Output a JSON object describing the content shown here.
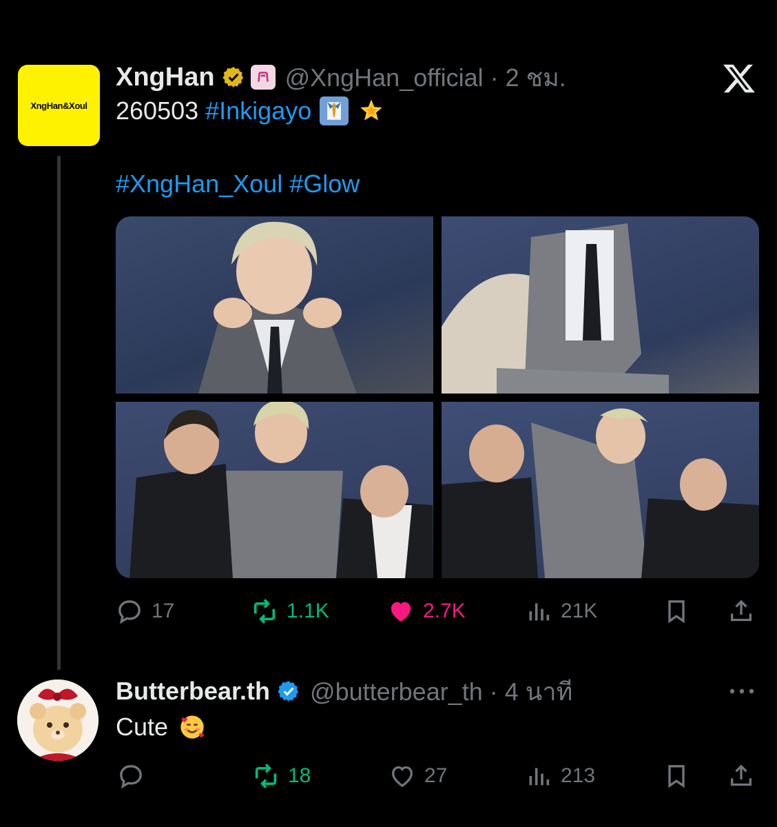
{
  "main_tweet": {
    "avatar_text": "XngHan&Xoul",
    "display_name": "XngHan",
    "handle_time": "@XngHan_official · 2 ชม.",
    "line1_prefix": "260503 ",
    "line1_tag": "#Inkigayo",
    "line2_tag1": "#XngHan_Xoul",
    "line2_tag2": "#Glow",
    "stats": {
      "replies": "17",
      "reposts": "1.1K",
      "likes": "2.7K",
      "views": "21K"
    }
  },
  "reply_tweet": {
    "display_name": "Butterbear.th",
    "handle_time": "@butterbear_th · 4 นาที",
    "text": "Cute",
    "stats": {
      "replies": "",
      "reposts": "18",
      "likes": "27",
      "views": "213"
    }
  },
  "colors": {
    "background": "#000000",
    "text": "#e7e9ea",
    "muted": "#71767b",
    "link": "#1d9bf0",
    "repost": "#00ba7c",
    "like": "#f91880",
    "avatar_yellow": "#fff200"
  },
  "icons": [
    "reply-icon",
    "repost-icon",
    "like-icon",
    "views-icon",
    "bookmark-icon",
    "share-icon",
    "verified-badge-icon",
    "x-logo-icon",
    "more-icon"
  ]
}
